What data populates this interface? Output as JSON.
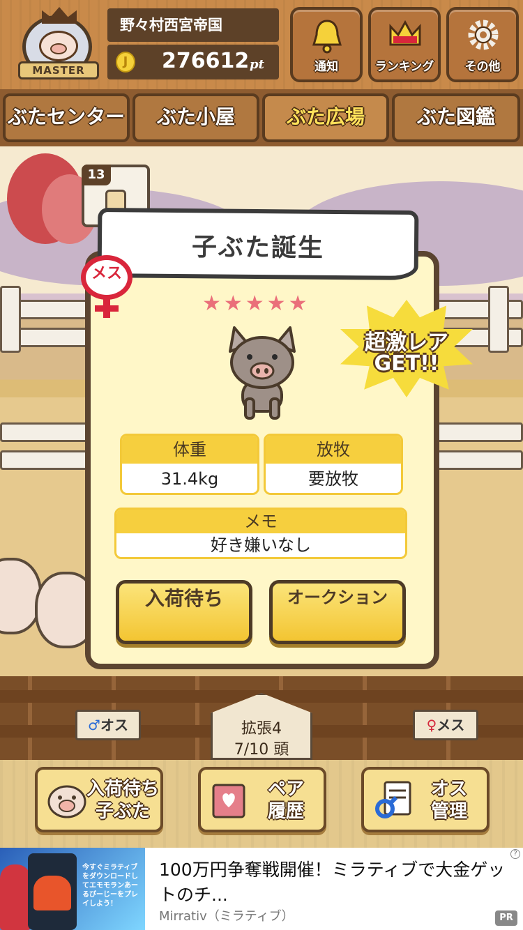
{
  "header": {
    "badge_label": "MASTER",
    "village_name": "野々村西宮帝国",
    "coin_glyph": "J",
    "points_value": "276612",
    "points_unit": "pt",
    "buttons": [
      {
        "label": "通知",
        "icon": "bell-icon"
      },
      {
        "label": "ランキング",
        "icon": "crown-icon"
      },
      {
        "label": "その他",
        "icon": "gear-icon"
      }
    ]
  },
  "tabs": [
    {
      "label": "ぶたセンター",
      "active": false
    },
    {
      "label": "ぶた小屋",
      "active": false
    },
    {
      "label": "ぶた広場",
      "active": true
    },
    {
      "label": "ぶた図鑑",
      "active": false
    }
  ],
  "scene": {
    "item_count": "13",
    "sign_male": {
      "symbol": "♂",
      "text": "オス"
    },
    "sign_female": {
      "symbol": "♀",
      "text": "メス"
    },
    "expand_label": "拡張4",
    "capacity_label": "7/10 頭"
  },
  "modal": {
    "title": "子ぶた誕生",
    "gender_label": "メス",
    "stars": "★★★★★",
    "rare_line1": "超激レア",
    "rare_line2": "GET!!",
    "weight": {
      "header": "体重",
      "value": "31.4kg"
    },
    "grazing": {
      "header": "放牧",
      "value": "要放牧"
    },
    "memo": {
      "header": "メモ",
      "value": "好き嫌いなし"
    },
    "button_wait": "入荷待ち",
    "button_auction": "オークション"
  },
  "bottom": {
    "buttons": [
      {
        "label_line1": "入荷待ち",
        "label_line2": "子ぶた",
        "icon": "piglet-icon"
      },
      {
        "label_line1": "ペア",
        "label_line2": "履歴",
        "icon": "heart-book-icon"
      },
      {
        "label_line1": "オス",
        "label_line2": "管理",
        "icon": "male-list-icon"
      }
    ]
  },
  "ad": {
    "title": "100万円争奪戦開催！ミラティブで大金ゲットのチ...",
    "source": "Mirrativ（ミラティブ）",
    "pr": "PR",
    "info": "?",
    "thumb_text": "今すぐミラティブをダウンロードしてエモモランあーるぴーじーをプレイしよう！"
  },
  "colors": {
    "accent_yellow": "#f6cf3e",
    "female_red": "#d9263b",
    "male_blue": "#2a6bd6",
    "wood_dark": "#5a3b1f"
  }
}
